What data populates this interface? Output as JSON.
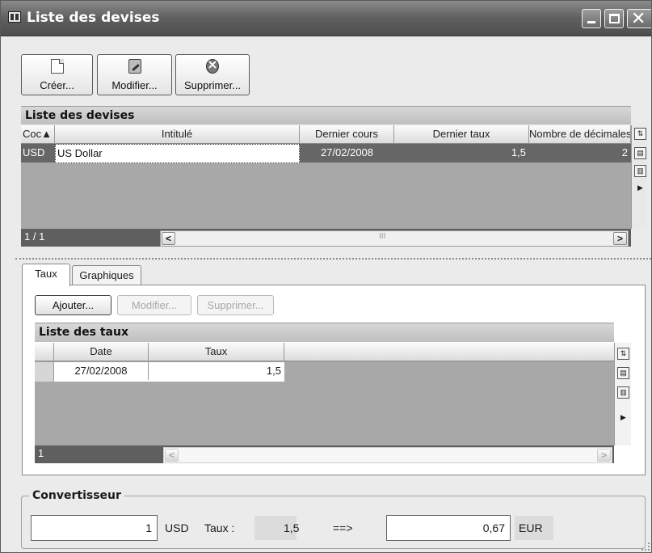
{
  "window": {
    "title": "Liste des devises"
  },
  "toolbar": {
    "create_label": "Créer...",
    "edit_label": "Modifier...",
    "delete_label": "Supprimer..."
  },
  "currencies": {
    "title": "Liste des devises",
    "columns": [
      "Coc▲",
      "Intitulé",
      "Dernier cours",
      "Dernier taux",
      "Nombre de décimales"
    ],
    "rows": [
      {
        "code": "USD",
        "label": "US Dollar",
        "last_date": "27/02/2008",
        "last_rate": "1,5",
        "decimals": "2"
      }
    ],
    "pager": "1 / 1",
    "scroll_mark": "III"
  },
  "tabs": [
    {
      "label": "Taux"
    },
    {
      "label": "Graphiques"
    }
  ],
  "rates": {
    "add_label": "Ajouter...",
    "edit_label": "Modifier...",
    "delete_label": "Supprimer...",
    "title": "Liste des taux",
    "columns": [
      "Date",
      "Taux"
    ],
    "rows": [
      {
        "date": "27/02/2008",
        "rate": "1,5"
      }
    ],
    "pager": "1"
  },
  "converter": {
    "title": "Convertisseur",
    "amount": "1",
    "from_currency": "USD",
    "rate_label": "Taux :",
    "rate_value": "1,5",
    "arrow": "==>",
    "result": "0,67",
    "to_currency": "EUR"
  },
  "colors": {
    "titlebar": "#5f5f5f",
    "selected_row": "#666666",
    "grid_background": "#a8a8a8"
  }
}
